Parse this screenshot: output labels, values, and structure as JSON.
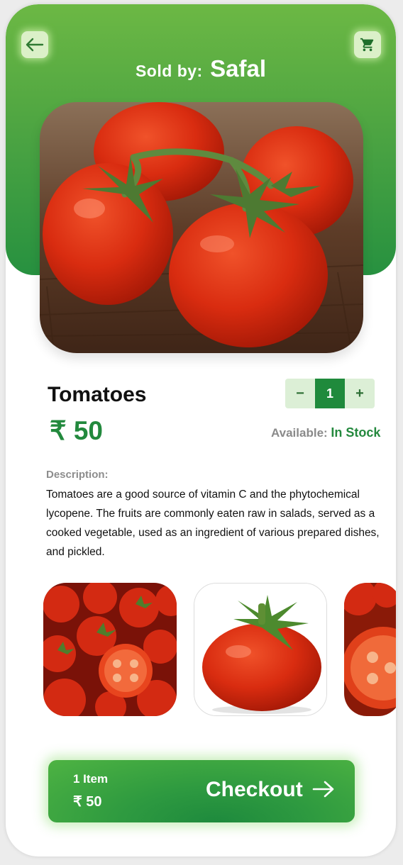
{
  "header": {
    "sold_by_label": "Sold by:",
    "seller_name": "Safal",
    "back_icon": "arrow-left-icon",
    "cart_icon": "cart-icon"
  },
  "product": {
    "name": "Tomatoes",
    "price": "₹ 50",
    "quantity": "1",
    "decrement_label": "−",
    "increment_label": "+",
    "availability_label": "Available:",
    "availability_value": "In Stock",
    "description_label": "Description:",
    "description": "Tomatoes are a good source of vitamin C and the phytochemical lycopene. The fruits are commonly eaten raw in salads, served as a cooked vegetable, used as an ingredient of various prepared dishes, and pickled."
  },
  "checkout": {
    "items": "1 Item",
    "total": "₹ 50",
    "label": "Checkout"
  },
  "colors": {
    "brand_green": "#279140",
    "light_green": "#6cb844",
    "tomato_red": "#d62a10"
  }
}
